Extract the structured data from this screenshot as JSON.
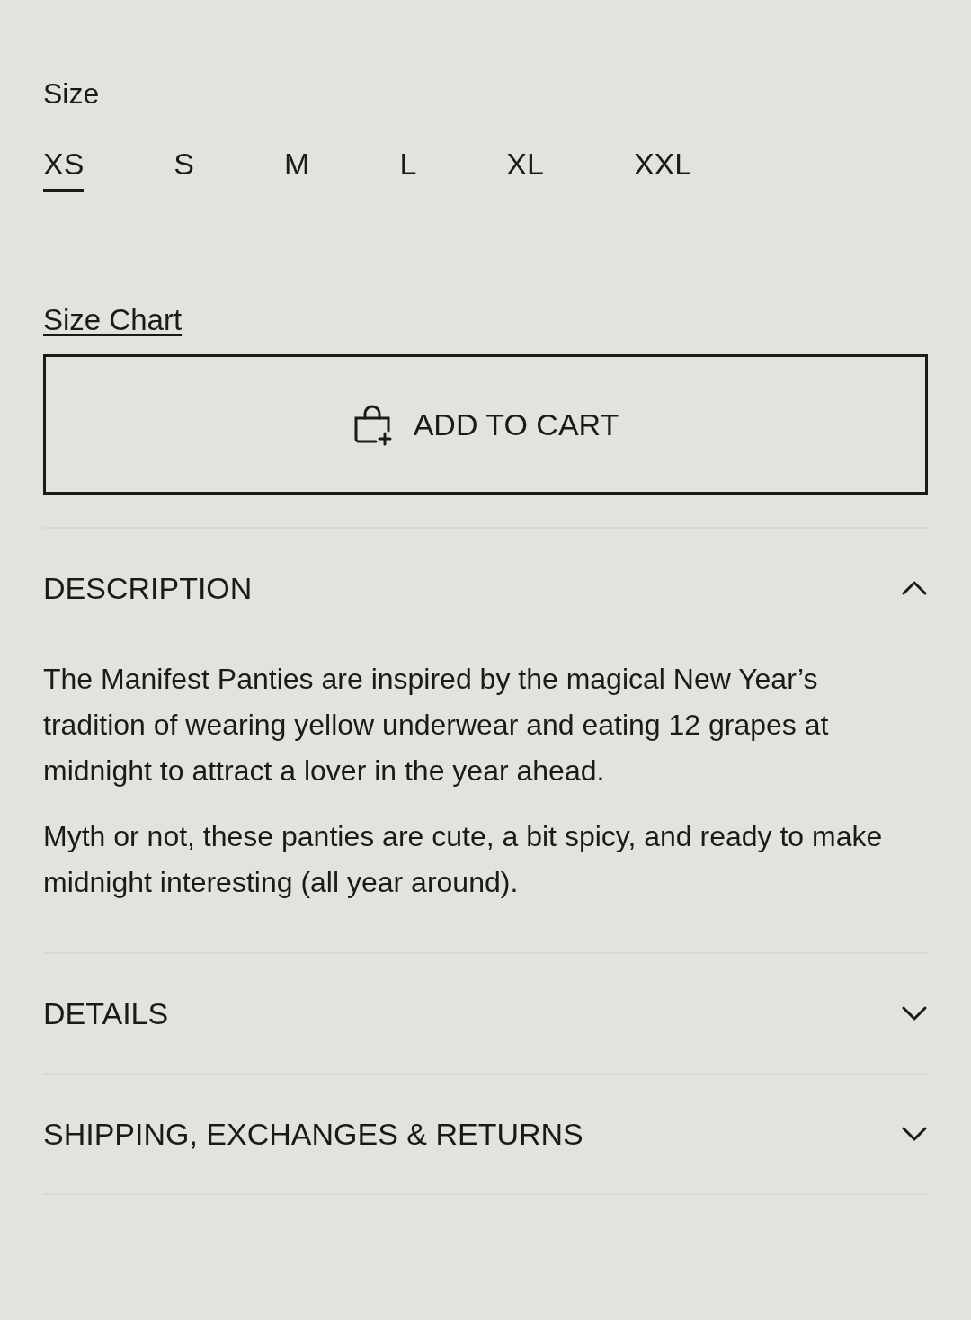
{
  "size_selector": {
    "label": "Size",
    "options": [
      {
        "label": "XS",
        "selected": true
      },
      {
        "label": "S",
        "selected": false
      },
      {
        "label": "M",
        "selected": false
      },
      {
        "label": "L",
        "selected": false
      },
      {
        "label": "XL",
        "selected": false
      },
      {
        "label": "XXL",
        "selected": false
      }
    ]
  },
  "size_chart_link": "Size Chart",
  "add_to_cart_button": "ADD TO CART",
  "accordions": [
    {
      "title": "DESCRIPTION",
      "expanded": true,
      "paragraphs": [
        "The Manifest Panties are inspired by the magical New Year’s tradition of wearing yellow underwear and eating 12 grapes at midnight to attract a lover in the year ahead.",
        "Myth or not, these panties are cute, a bit spicy, and ready to make midnight interesting (all year around)."
      ]
    },
    {
      "title": "DETAILS",
      "expanded": false
    },
    {
      "title": "SHIPPING, EXCHANGES & RETURNS",
      "expanded": false
    }
  ]
}
